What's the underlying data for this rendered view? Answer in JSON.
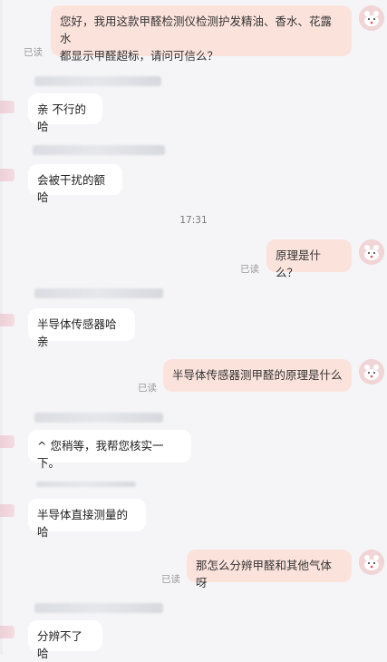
{
  "timestamp": "17:31",
  "read_label": "已读",
  "messages": [
    {
      "from": "user",
      "text": "您好，我用这款甲醛检测仪检测护发精油、香水、花露水\n都显示甲醛超标，请问可信么？"
    },
    {
      "from": "agent",
      "text": "亲 不行的哈"
    },
    {
      "from": "agent",
      "text": "会被干扰的额哈"
    },
    {
      "from": "user",
      "text": "原理是什么？"
    },
    {
      "from": "agent",
      "text": "半导体传感器哈亲"
    },
    {
      "from": "user",
      "text": "半导体传感器测甲醛的原理是什么"
    },
    {
      "from": "agent",
      "text": "^ 您稍等，我帮您核实一下。"
    },
    {
      "from": "agent",
      "text": "半导体直接测量的哈"
    },
    {
      "from": "user",
      "text": "那怎么分辨甲醛和其他气体呀"
    },
    {
      "from": "agent",
      "text": "分辨不了哈"
    }
  ],
  "colors": {
    "outgoing_bubble": "#fbe3dc",
    "incoming_bubble": "#ffffff",
    "background": "#f5f5f7",
    "read_text": "#999999"
  },
  "icons": {
    "user_avatar": "bear-avatar-icon",
    "agent_avatar": "shop-avatar-icon"
  }
}
